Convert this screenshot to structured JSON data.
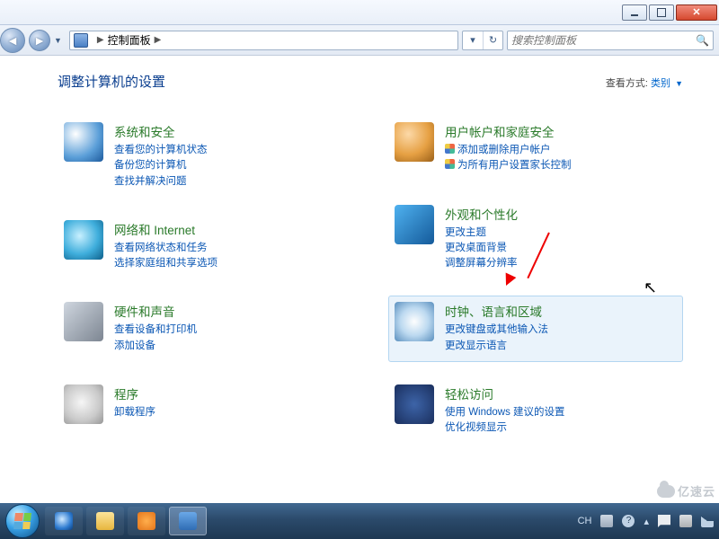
{
  "window": {
    "min_label": "Minimize",
    "max_label": "Maximize",
    "close_label": "Close"
  },
  "navbar": {
    "breadcrumb_root": "控制面板",
    "search_placeholder": "搜索控制面板"
  },
  "header": {
    "title": "调整计算机的设置",
    "viewby_label": "查看方式:",
    "viewby_value": "类别"
  },
  "left_col": [
    {
      "title": "系统和安全",
      "links": [
        "查看您的计算机状态",
        "备份您的计算机",
        "查找并解决问题"
      ],
      "shields": []
    },
    {
      "title": "网络和 Internet",
      "links": [
        "查看网络状态和任务",
        "选择家庭组和共享选项"
      ],
      "shields": []
    },
    {
      "title": "硬件和声音",
      "links": [
        "查看设备和打印机",
        "添加设备"
      ],
      "shields": []
    },
    {
      "title": "程序",
      "links": [
        "卸载程序"
      ],
      "shields": []
    }
  ],
  "right_col": [
    {
      "title": "用户帐户和家庭安全",
      "links": [
        "添加或删除用户帐户",
        "为所有用户设置家长控制"
      ],
      "shields": [
        0,
        1
      ]
    },
    {
      "title": "外观和个性化",
      "links": [
        "更改主题",
        "更改桌面背景",
        "调整屏幕分辨率"
      ],
      "shields": []
    },
    {
      "title": "时钟、语言和区域",
      "links": [
        "更改键盘或其他输入法",
        "更改显示语言"
      ],
      "shields": [],
      "highlighted": true
    },
    {
      "title": "轻松访问",
      "links": [
        "使用 Windows 建议的设置",
        "优化视频显示"
      ],
      "shields": []
    }
  ],
  "taskbar": {
    "ime": "CH"
  },
  "watermark": "亿速云"
}
